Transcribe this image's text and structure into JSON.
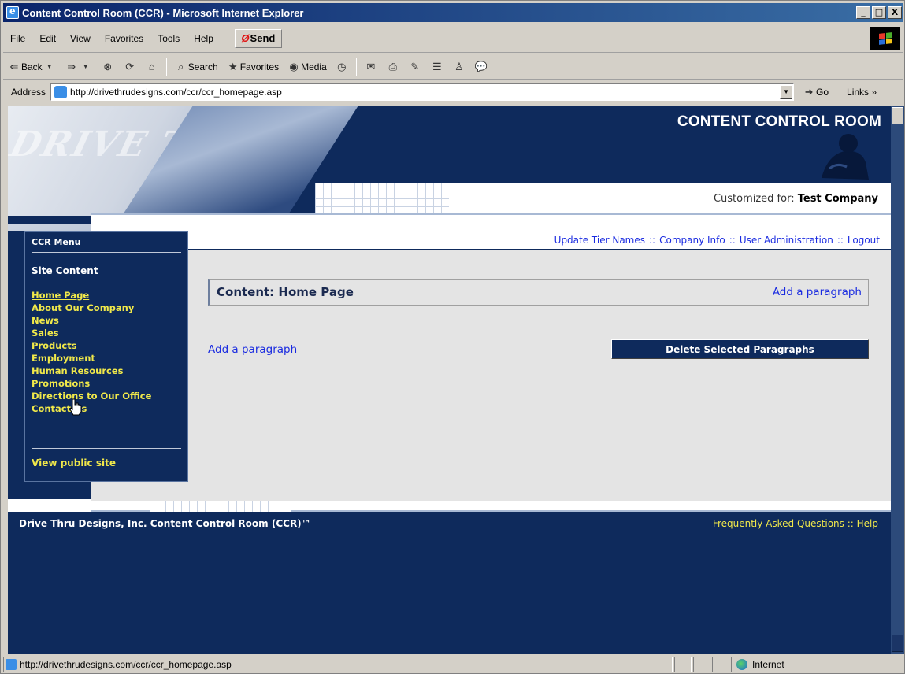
{
  "window": {
    "title": "Content Control Room (CCR) - Microsoft Internet Explorer",
    "min_label": "_",
    "max_label": "□",
    "close_label": "X"
  },
  "menubar": {
    "items": [
      "File",
      "Edit",
      "View",
      "Favorites",
      "Tools",
      "Help"
    ],
    "send_label": "Send"
  },
  "toolbar": {
    "back_label": "Back",
    "search_label": "Search",
    "favorites_label": "Favorites",
    "media_label": "Media"
  },
  "addressbar": {
    "label": "Address",
    "url": "http://drivethrudesigns.com/ccr/ccr_homepage.asp",
    "go_label": "Go",
    "links_label": "Links"
  },
  "banner": {
    "title": "CONTENT CONTROL ROOM",
    "watermark": "DRIVE THRU",
    "customized_prefix": "Customized for:",
    "company": "Test Company"
  },
  "topnav": {
    "links": [
      "Update Tier Names",
      "Company Info",
      "User Administration",
      "Logout"
    ],
    "separator": "::"
  },
  "ccr_menu": {
    "heading": "CCR Menu",
    "section": "Site Content",
    "items": [
      "Home Page",
      "About Our Company",
      "News",
      "Sales",
      "Products",
      "Employment",
      "Human Resources",
      "Promotions",
      "Directions to Our Office",
      "Contact Us"
    ],
    "view_public": "View public site"
  },
  "content": {
    "header_title": "Content: Home Page",
    "header_add_paragraph": "Add a paragraph",
    "add_paragraph": "Add a paragraph",
    "delete_button": "Delete Selected Paragraphs"
  },
  "footer": {
    "left": "Drive Thru Designs, Inc.  Content Control Room (CCR)™",
    "faq": "Frequently Asked Questions",
    "separator": "::",
    "help": "Help"
  },
  "statusbar": {
    "url": "http://drivethrudesigns.com/ccr/ccr_homepage.asp",
    "zone": "Internet"
  },
  "colors": {
    "navy": "#0e2a5c",
    "link_blue": "#1a2be0",
    "menu_yellow": "#f0e84a",
    "content_gray": "#e4e4e4"
  }
}
